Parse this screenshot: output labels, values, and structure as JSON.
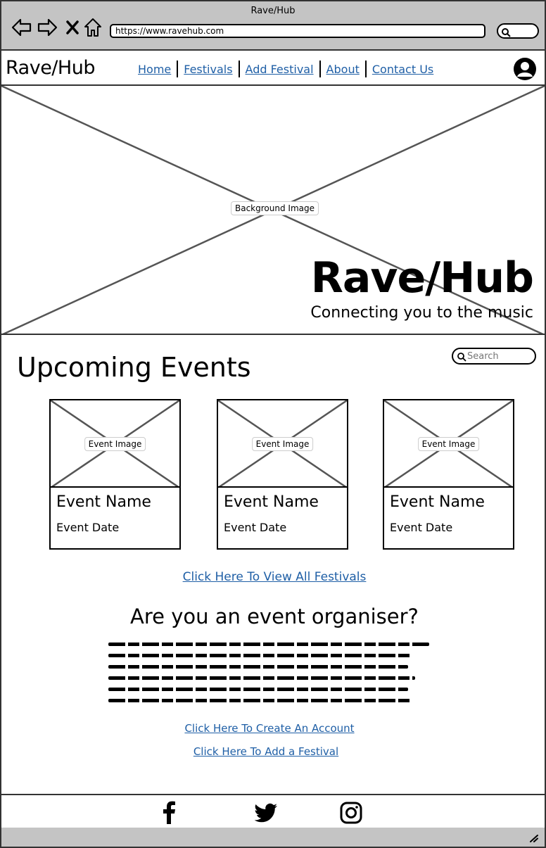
{
  "browser": {
    "title": "Rave/Hub",
    "url": "https://www.ravehub.com"
  },
  "navbar": {
    "logo": "Rave/Hub",
    "links": [
      "Home",
      "Festivals",
      "Add Festival",
      "About",
      "Contact Us"
    ]
  },
  "hero": {
    "image_label": "Background Image",
    "title": "Rave/Hub",
    "subtitle": "Connecting you to the music"
  },
  "events": {
    "title": "Upcoming Events",
    "search_placeholder": "Search",
    "cards": [
      {
        "image_label": "Event Image",
        "name": "Event Name",
        "date": "Event Date"
      },
      {
        "image_label": "Event Image",
        "name": "Event Name",
        "date": "Event Date"
      },
      {
        "image_label": "Event Image",
        "name": "Event Name",
        "date": "Event Date"
      }
    ],
    "view_all_link": "Click Here To View All Festivals"
  },
  "organiser": {
    "title": "Are you an event organiser?",
    "create_account_link": "Click Here To Create An Account",
    "add_festival_link": "Click Here To Add a Festival"
  },
  "footer": {
    "icons": [
      "facebook-icon",
      "twitter-icon",
      "instagram-icon"
    ]
  },
  "colors": {
    "link": "#1f5fa6",
    "chrome": "#c4c4c4"
  }
}
